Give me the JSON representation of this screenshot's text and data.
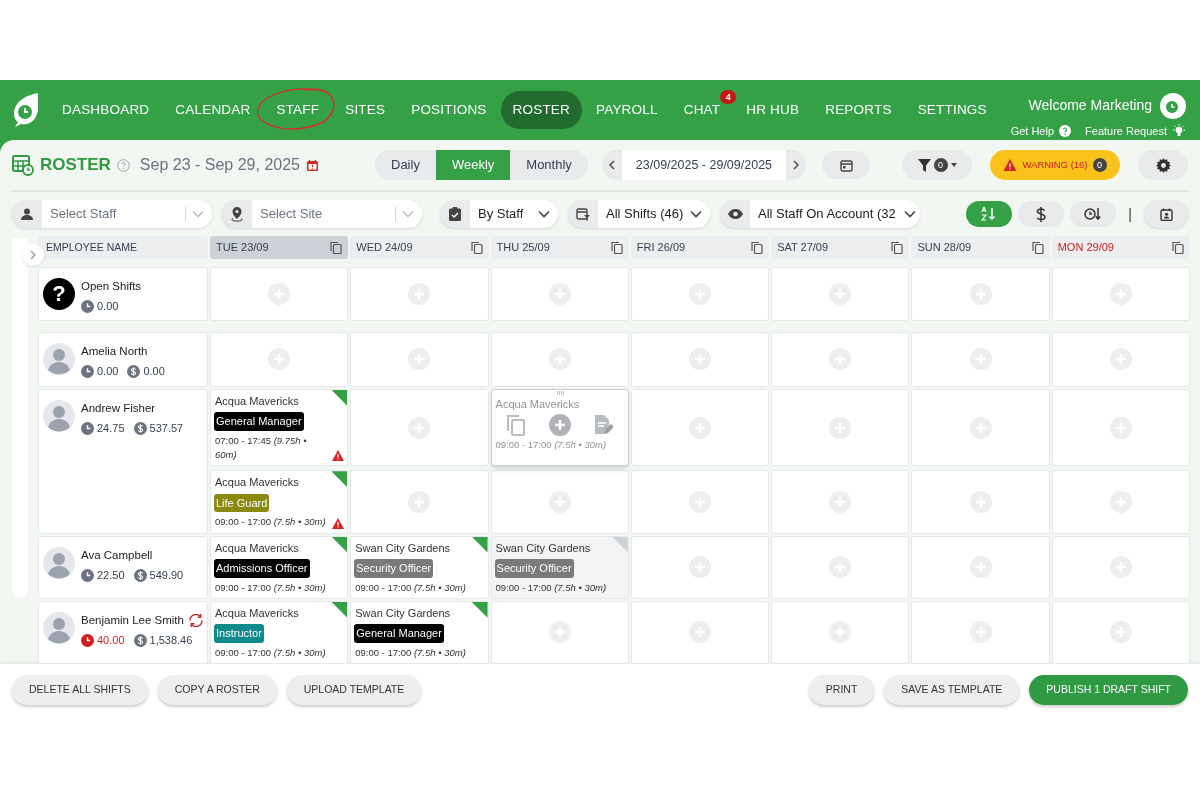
{
  "nav": {
    "items": [
      {
        "label": "DASHBOARD",
        "selected": false,
        "circled": false
      },
      {
        "label": "CALENDAR",
        "selected": false,
        "circled": false
      },
      {
        "label": "STAFF",
        "selected": false,
        "circled": true
      },
      {
        "label": "SITES",
        "selected": false,
        "circled": false
      },
      {
        "label": "POSITIONS",
        "selected": false,
        "circled": false
      },
      {
        "label": "ROSTER",
        "selected": true,
        "circled": false
      },
      {
        "label": "PAYROLL",
        "selected": false,
        "circled": false
      },
      {
        "label": "CHAT",
        "selected": false,
        "circled": false,
        "badge": "4"
      },
      {
        "label": "HR HUB",
        "selected": false,
        "circled": false
      },
      {
        "label": "REPORTS",
        "selected": false,
        "circled": false
      },
      {
        "label": "SETTINGS",
        "selected": false,
        "circled": false
      }
    ],
    "welcome": "Welcome Marketing",
    "help": "Get Help",
    "feature": "Feature Request"
  },
  "toolbar": {
    "title": "ROSTER",
    "range": "Sep 23 - Sep 29, 2025",
    "views": [
      {
        "label": "Daily",
        "selected": false
      },
      {
        "label": "Weekly",
        "selected": true
      },
      {
        "label": "Monthly",
        "selected": false
      }
    ],
    "date_range": "23/09/2025 - 29/09/2025",
    "filter_count": "0",
    "warning": "WARNING (16)",
    "warning_count": "0"
  },
  "filters": {
    "staff": {
      "placeholder": "Select Staff"
    },
    "site": {
      "placeholder": "Select Site"
    },
    "group": "By Staff",
    "shifts": "All Shifts (46)",
    "staff_view": "All Staff On Account (32",
    "sorts": [
      {
        "kind": "az",
        "selected": true
      },
      {
        "kind": "dollar",
        "selected": false
      },
      {
        "kind": "clock",
        "selected": false
      }
    ],
    "separator": "|"
  },
  "grid": {
    "name_header": "EMPLOYEE NAME",
    "days": [
      {
        "label": "TUE 23/09",
        "selected": true,
        "holiday": false
      },
      {
        "label": "WED 24/09",
        "selected": false,
        "holiday": false
      },
      {
        "label": "THU 25/09",
        "selected": false,
        "holiday": false
      },
      {
        "label": "FRI 26/09",
        "selected": false,
        "holiday": false
      },
      {
        "label": "SAT 27/09",
        "selected": false,
        "holiday": false
      },
      {
        "label": "SUN 28/09",
        "selected": false,
        "holiday": false
      },
      {
        "label": "MON 29/09",
        "selected": false,
        "holiday": true
      }
    ],
    "rows": [
      {
        "kind": "open",
        "avatar_text": "?",
        "name": "Open Shifts",
        "hours": "0.00",
        "over_hours": false,
        "swap": false,
        "lanes": [
          [
            {
              "kind": "empty"
            },
            {
              "kind": "empty"
            },
            {
              "kind": "empty"
            },
            {
              "kind": "empty"
            },
            {
              "kind": "empty"
            },
            {
              "kind": "empty"
            },
            {
              "kind": "empty"
            }
          ]
        ]
      },
      {
        "kind": "staff",
        "name": "Amelia North",
        "hours": "0.00",
        "pay": "0.00",
        "over_hours": false,
        "swap": false,
        "lanes": [
          [
            {
              "kind": "empty"
            },
            {
              "kind": "empty"
            },
            {
              "kind": "empty"
            },
            {
              "kind": "empty"
            },
            {
              "kind": "empty"
            },
            {
              "kind": "empty"
            },
            {
              "kind": "empty"
            }
          ]
        ]
      },
      {
        "kind": "staff",
        "name": "Andrew Fisher",
        "hours": "24.75",
        "pay": "537.57",
        "over_hours": false,
        "swap": false,
        "lanes": [
          [
            {
              "kind": "shift",
              "site": "Acqua Mavericks",
              "role": "General Manager",
              "color": "#000000",
              "time": "07:00 - 17:45 *(9.75h • 60m)*",
              "draft": false,
              "warning": true
            },
            {
              "kind": "empty"
            },
            {
              "kind": "hover",
              "site": "Acqua Mavericks",
              "time": "09:00 - 17:00 *(7.5h • 30m)*"
            },
            {
              "kind": "empty"
            },
            {
              "kind": "empty"
            },
            {
              "kind": "empty"
            },
            {
              "kind": "empty"
            }
          ],
          [
            {
              "kind": "shift",
              "site": "Acqua Mavericks",
              "role": "Life Guard",
              "color": "#8a8a10",
              "time": "09:00 - 17:00 *(7.5h • 30m)*",
              "draft": false,
              "warning": true
            },
            {
              "kind": "empty"
            },
            {
              "kind": "empty"
            },
            {
              "kind": "empty"
            },
            {
              "kind": "empty"
            },
            {
              "kind": "empty"
            },
            {
              "kind": "empty"
            }
          ]
        ]
      },
      {
        "kind": "staff",
        "name": "Ava Campbell",
        "hours": "22.50",
        "pay": "549.90",
        "over_hours": false,
        "swap": false,
        "lanes": [
          [
            {
              "kind": "shift",
              "site": "Acqua Mavericks",
              "role": "Admissions Officer",
              "color": "#000000",
              "time": "09:00 - 17:00 *(7.5h • 30m)*",
              "draft": false,
              "warning": false
            },
            {
              "kind": "shift",
              "site": "Swan City Gardens",
              "role": "Security Officer",
              "color": "#7a7a7a",
              "time": "09:00 - 17:00 *(7.5h • 30m)*",
              "draft": false,
              "warning": false
            },
            {
              "kind": "shift",
              "site": "Swan City Gardens",
              "role": "Security Officer",
              "color": "#7a7a7a",
              "time": "09:00 - 17:00 *(7.5h • 30m)*",
              "draft": true,
              "warning": false
            },
            {
              "kind": "empty"
            },
            {
              "kind": "empty"
            },
            {
              "kind": "empty"
            },
            {
              "kind": "empty"
            }
          ]
        ]
      },
      {
        "kind": "staff",
        "name": "Benjamin Lee Smith",
        "hours": "40.00",
        "pay": "1,538.46",
        "over_hours": true,
        "swap": true,
        "lanes": [
          [
            {
              "kind": "shift",
              "site": "Acqua Mavericks",
              "role": "Instructor",
              "color": "#0f8b8d",
              "time": "09:00 - 17:00 *(7.5h • 30m)*",
              "draft": false,
              "warning": false
            },
            {
              "kind": "shift",
              "site": "Swan City Gardens",
              "role": "General Manager",
              "color": "#000000",
              "time": "09:00 - 17:00 *(7.5h • 30m)*",
              "draft": false,
              "warning": false
            },
            {
              "kind": "empty"
            },
            {
              "kind": "empty"
            },
            {
              "kind": "empty"
            },
            {
              "kind": "empty"
            },
            {
              "kind": "empty"
            }
          ]
        ]
      }
    ]
  },
  "footer": {
    "left": [
      {
        "label": "DELETE ALL SHIFTS",
        "kind": "plain"
      },
      {
        "label": "COPY A ROSTER",
        "kind": "plain"
      },
      {
        "label": "UPLOAD TEMPLATE",
        "kind": "plain"
      }
    ],
    "right": [
      {
        "label": "PRINT",
        "kind": "plain"
      },
      {
        "label": "SAVE AS TEMPLATE",
        "kind": "plain"
      },
      {
        "label": "PUBLISH 1 DRAFT SHIFT",
        "kind": "primary"
      }
    ]
  }
}
